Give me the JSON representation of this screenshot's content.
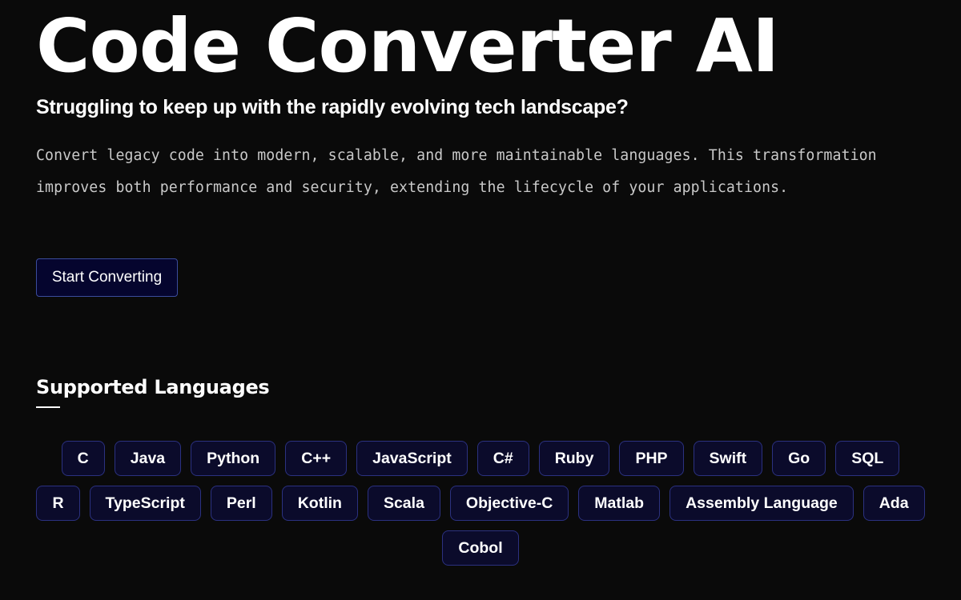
{
  "hero": {
    "title": "Code Converter AI",
    "subtitle": "Struggling to keep up with the rapidly evolving tech landscape?",
    "description": "Convert legacy code into modern, scalable, and more maintainable languages. This transformation improves both performance and security, extending the lifecycle of your applications.",
    "cta_label": "Start Converting"
  },
  "languages": {
    "title": "Supported Languages",
    "items": [
      "C",
      "Java",
      "Python",
      "C++",
      "JavaScript",
      "C#",
      "Ruby",
      "PHP",
      "Swift",
      "Go",
      "SQL",
      "R",
      "TypeScript",
      "Perl",
      "Kotlin",
      "Scala",
      "Objective-C",
      "Matlab",
      "Assembly Language",
      "Ada",
      "Cobol"
    ]
  },
  "colors": {
    "background": "#0a0a0a",
    "chip_background": "#0b0b2b",
    "chip_border": "#2b3180",
    "button_background": "#05052e",
    "button_border": "#3b4c9c",
    "description_text": "#c9c9c9"
  }
}
